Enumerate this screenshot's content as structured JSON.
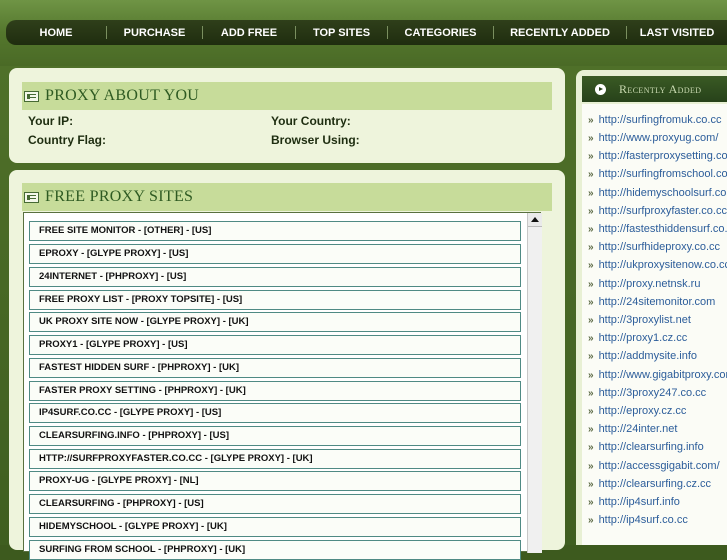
{
  "nav": {
    "items": [
      "HOME",
      "PURCHASE",
      "ADD FREE",
      "TOP SITES",
      "CATEGORIES",
      "RECENTLY ADDED",
      "LAST VISITED"
    ]
  },
  "about": {
    "title": "PROXY ABOUT YOU",
    "your_ip": "Your IP:",
    "your_country": "Your Country:",
    "country_flag": "Country Flag:",
    "browser_using": "Browser Using:"
  },
  "free_sites": {
    "title": "FREE PROXY SITES",
    "rows": [
      "FREE SITE MONITOR - [OTHER] - [US]",
      "EPROXY - [GLYPE PROXY] - [US]",
      "24INTERNET - [PHPROXY] - [US]",
      "FREE PROXY LIST - [PROXY TOPSITE] - [US]",
      "UK PROXY SITE NOW - [GLYPE PROXY] - [UK]",
      "PROXY1 - [GLYPE PROXY] - [US]",
      "FASTEST HIDDEN SURF - [PHPROXY] - [UK]",
      "FASTER PROXY SETTING - [PHPROXY] - [UK]",
      "IP4SURF.CO.CC - [GLYPE PROXY] - [US]",
      "CLEARSURFING.INFO - [PHPROXY] - [US]",
      "HTTP://SURFPROXYFASTER.CO.CC - [GLYPE PROXY] - [UK]",
      "PROXY-UG - [GLYPE PROXY] - [NL]",
      "CLEARSURFING - [PHPROXY] - [US]",
      "HIDEMYSCHOOL - [GLYPE PROXY] - [UK]",
      "SURFING FROM SCHOOL - [PHPROXY] - [UK]"
    ]
  },
  "recent": {
    "title": "Recently Added",
    "items": [
      "http://surfingfromuk.co.cc",
      "http://www.proxyug.com/",
      "http://fasterproxysetting.co.cc",
      "http://surfingfromschool.co.cc",
      "http://hidemyschoolsurf.co.cc",
      "http://surfproxyfaster.co.cc",
      "http://fastesthiddensurf.co.cc",
      "http://surfhideproxy.co.cc",
      "http://ukproxysitenow.co.cc",
      "http://proxy.netnsk.ru",
      "http://24sitemonitor.com",
      "http://3proxylist.net",
      "http://proxy1.cz.cc",
      "http://addmysite.info",
      "http://www.gigabitproxy.com",
      "http://3proxy247.co.cc",
      "http://eproxy.cz.cc",
      "http://24inter.net",
      "http://clearsurfing.info",
      "http://accessgigabit.com/",
      "http://clearsurfing.cz.cc",
      "http://ip4surf.info",
      "http://ip4surf.co.cc"
    ]
  }
}
